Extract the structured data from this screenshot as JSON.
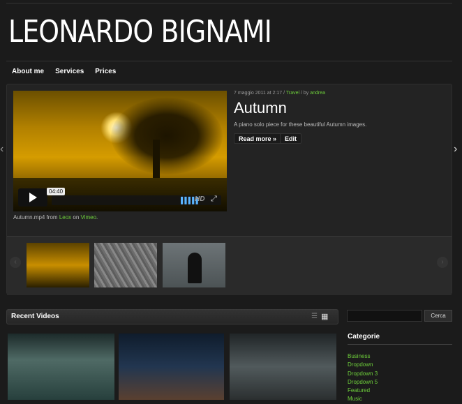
{
  "site": {
    "title": "LEONARDO BIGNAMI"
  },
  "nav": {
    "items": [
      "About me",
      "Services",
      "Prices"
    ]
  },
  "featured": {
    "meta_date": "7 maggio 2011 at 2:17 / ",
    "meta_category": "Travel",
    "meta_by": " / by ",
    "meta_author": "andrea",
    "title": "Autumn",
    "excerpt": "A piano solo piece for these beautiful Autumn images.",
    "read_more": "Read more »",
    "edit": "Edit",
    "video_time": "04:40",
    "video_hd": "HD",
    "caption_file": "Autumn.mp4 from ",
    "caption_author": "Leox",
    "caption_on": " on ",
    "caption_site": "Vimeo",
    "caption_end": "."
  },
  "recent": {
    "title": "Recent Videos"
  },
  "search": {
    "value": "",
    "button": "Cerca"
  },
  "categories": {
    "title": "Categorie",
    "items": [
      "Business",
      "Dropdown",
      "Dropdown 3",
      "Dropdown 5",
      "Featured",
      "Music"
    ]
  },
  "colors": {
    "link": "#6ecf3b",
    "background": "#1b1b1b"
  }
}
